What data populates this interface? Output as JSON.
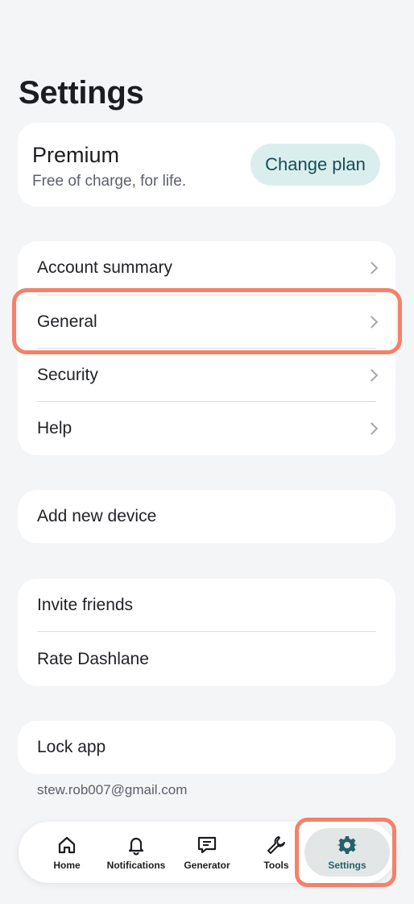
{
  "header": {
    "title": "Settings"
  },
  "premium": {
    "plan_name": "Premium",
    "plan_description": "Free of charge, for life.",
    "change_plan_label": "Change plan"
  },
  "main_menu": {
    "items": [
      {
        "label": "Account summary"
      },
      {
        "label": "General"
      },
      {
        "label": "Security"
      },
      {
        "label": "Help"
      }
    ]
  },
  "device": {
    "add_new_device_label": "Add new device"
  },
  "social": {
    "invite_friends_label": "Invite friends",
    "rate_label": "Rate Dashlane"
  },
  "lock": {
    "lock_app_label": "Lock app"
  },
  "account": {
    "email": "stew.rob007@gmail.com"
  },
  "tabbar": {
    "tabs": [
      {
        "label": "Home",
        "icon": "home-icon"
      },
      {
        "label": "Notifications",
        "icon": "bell-icon"
      },
      {
        "label": "Generator",
        "icon": "message-icon"
      },
      {
        "label": "Tools",
        "icon": "wrench-icon"
      },
      {
        "label": "Settings",
        "icon": "gear-icon",
        "active": true
      }
    ]
  },
  "colors": {
    "background": "#f4f5f7",
    "accent": "#154f59",
    "highlight": "#f4816a",
    "change_plan_bg": "#dbeeee"
  }
}
